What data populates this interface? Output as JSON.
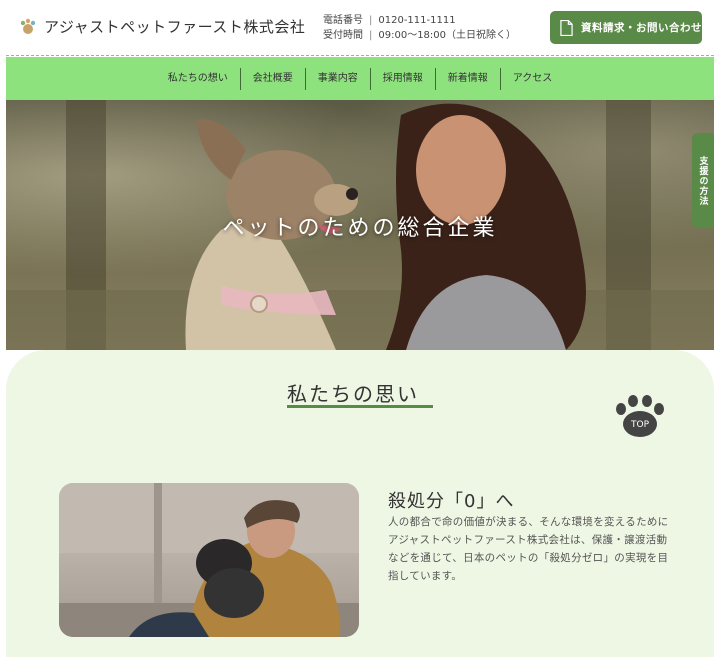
{
  "header": {
    "company_name": "アジャストペットファースト株式会社",
    "phone_label": "電話番号",
    "phone_number": "0120-111-1111",
    "hours_label": "受付時間",
    "hours_value": "09:00～18:00（土日祝除く）",
    "cta_label": "資料請求・お問い合わせ"
  },
  "nav": {
    "items": [
      {
        "label": "私たちの想い"
      },
      {
        "label": "会社概要"
      },
      {
        "label": "事業内容"
      },
      {
        "label": "採用情報"
      },
      {
        "label": "新着情報"
      },
      {
        "label": "アクセス"
      }
    ]
  },
  "hero": {
    "title": "ペットのための総合企業"
  },
  "side_tab": {
    "label": "支援の方法"
  },
  "section": {
    "title": "私たちの思い",
    "top_button_label": "TOP",
    "feature_title": "殺処分「0」へ",
    "feature_body": "人の都合で命の価値が決まる、そんな環境を変えるためにアジャストペットファースト株式会社は、保護・譲渡活動などを通じて、日本のペットの「殺処分ゼロ」の実現を目指しています。"
  },
  "colors": {
    "accent": "#5a8a47",
    "nav_bg": "#8ee27e",
    "section_bg": "#eef6e4"
  },
  "icons": {
    "logo": "paw-logo-icon",
    "cta": "document-icon",
    "top": "paw-top-icon"
  }
}
